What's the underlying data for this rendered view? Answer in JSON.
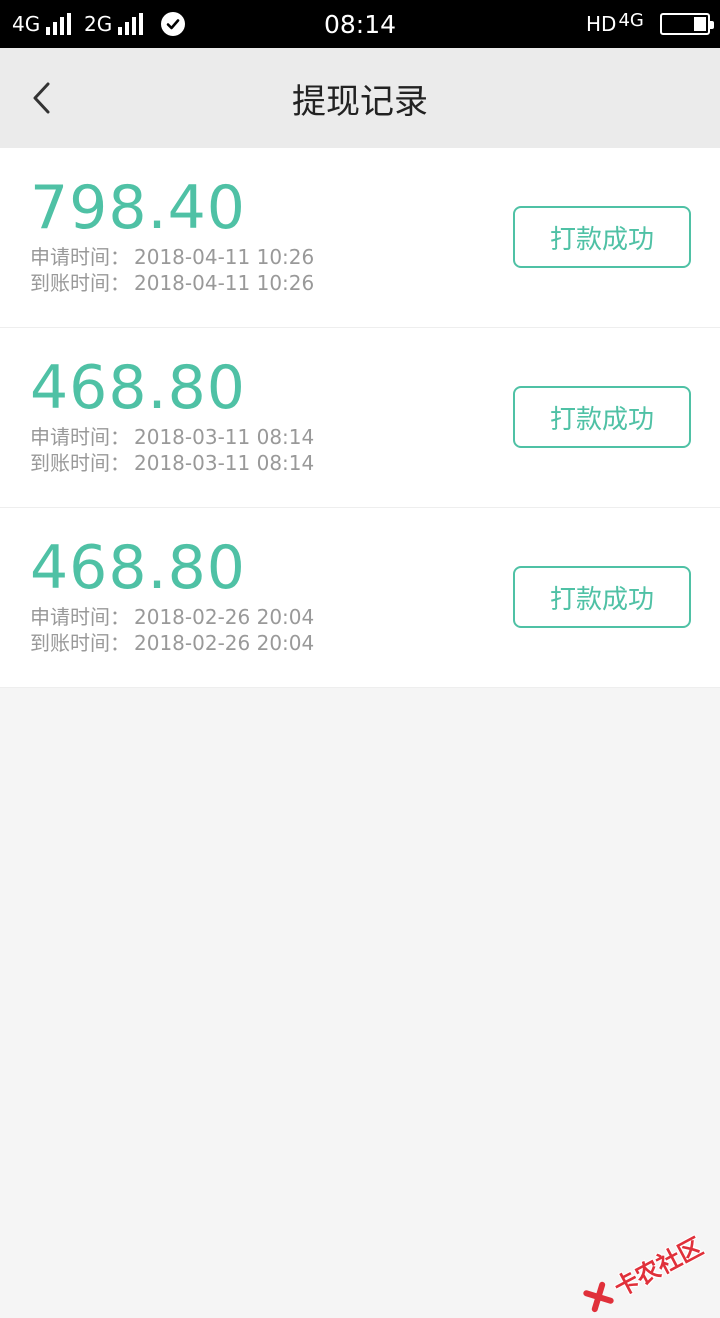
{
  "status_bar": {
    "sim1_label": "4G",
    "sim2_label": "2G",
    "time": "08:14",
    "hd_label": "HD",
    "net_label": "4G"
  },
  "header": {
    "title": "提现记录",
    "back_icon": "chevron-left-icon"
  },
  "records": [
    {
      "amount": "798.40",
      "apply_label": "申请时间：",
      "apply_time": "2018-04-11 10:26",
      "arrive_label": "到账时间：",
      "arrive_time": "2018-04-11 10:26",
      "status": "打款成功"
    },
    {
      "amount": "468.80",
      "apply_label": "申请时间：",
      "apply_time": "2018-03-11 08:14",
      "arrive_label": "到账时间：",
      "arrive_time": "2018-03-11 08:14",
      "status": "打款成功"
    },
    {
      "amount": "468.80",
      "apply_label": "申请时间：",
      "apply_time": "2018-02-26 20:04",
      "arrive_label": "到账时间：",
      "arrive_time": "2018-02-26 20:04",
      "status": "打款成功"
    }
  ],
  "watermark": {
    "text": "卡农社区"
  },
  "colors": {
    "accent": "#4fc1a5",
    "nav_bg": "#ebebeb",
    "page_bg": "#f5f5f5",
    "muted_text": "#999999",
    "watermark": "#e0303a"
  }
}
